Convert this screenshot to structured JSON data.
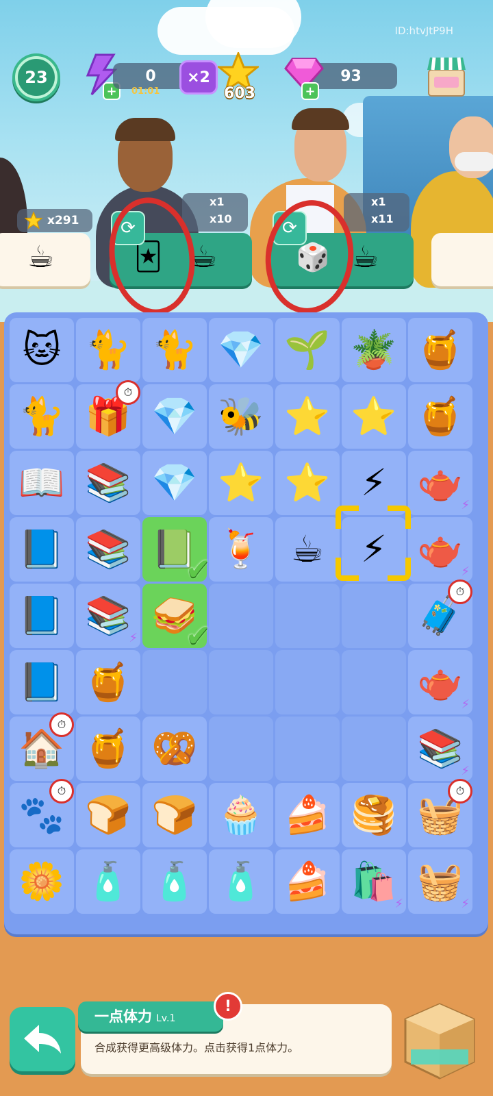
{
  "player_id": "ID:htvJtP9H",
  "level": "23",
  "energy": {
    "value": "0",
    "timer": "01:01",
    "multiplier": "×2",
    "plus": "+"
  },
  "coins": "603",
  "gems": {
    "value": "93",
    "plus": "+"
  },
  "star_badge": "x291",
  "orders": [
    {
      "rewards": [
        "x1",
        "x10"
      ]
    },
    {
      "rewards": [
        "x1",
        "x11"
      ]
    }
  ],
  "board": [
    [
      "🐱",
      "🐈",
      "🐈",
      "💎",
      "🌱",
      "🪴",
      "🍯"
    ],
    [
      "🐈",
      "🎁",
      "💎",
      "🐝",
      "⭐",
      "⭐",
      "🍯"
    ],
    [
      "📖",
      "📚",
      "💎",
      "⭐",
      "⭐",
      "⚡",
      "🫖"
    ],
    [
      "📘",
      "📚",
      "📗",
      "🍹",
      "☕",
      "⚡",
      "🫖"
    ],
    [
      "📘",
      "📚",
      "🥪",
      "",
      "",
      "",
      "🧳"
    ],
    [
      "📘",
      "🍯",
      "",
      "",
      "",
      "",
      "🫖"
    ],
    [
      "🏠",
      "🍯",
      "🥨",
      "",
      "",
      "",
      "📚"
    ],
    [
      "🐾",
      "🍞",
      "🍞",
      "🧁",
      "🍰",
      "🥞",
      "🧺"
    ],
    [
      "🌼",
      "🧴",
      "🧴",
      "🧴",
      "🍰",
      "🛍️",
      "🧺"
    ]
  ],
  "panel": {
    "title": "一点体力",
    "level": "Lv.1",
    "alert": "!",
    "description": "合成获得更高级体力。点击获得1点体力。"
  },
  "icons": {
    "back": "back-arrow-icon",
    "box": "storage-box-icon",
    "shop": "shop-icon"
  }
}
